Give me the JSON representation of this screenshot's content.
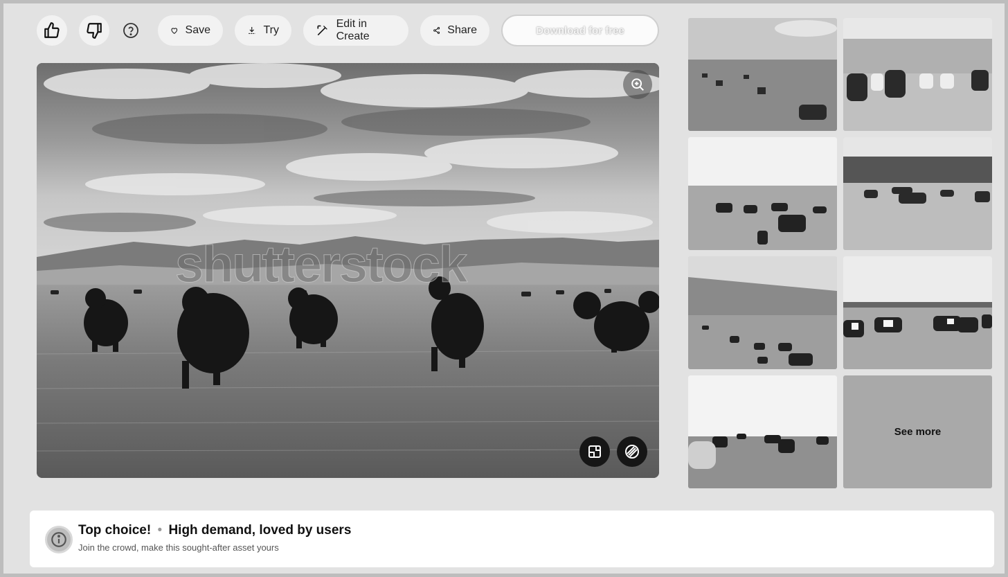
{
  "toolbar": {
    "like_label": "",
    "dislike_label": "",
    "save_label": "Save",
    "try_label": "Try",
    "edit_label": "Edit in Create",
    "share_label": "Share",
    "download_label": "Download for free"
  },
  "hero": {
    "watermark": "shutterstock"
  },
  "grid": {
    "see_more_label": "See more"
  },
  "banner": {
    "title": "Top choice!",
    "separator": "•",
    "highlight": "High demand, loved by users",
    "subtitle": "Join the crowd, make this sought-after asset yours"
  },
  "icons": {
    "like": "thumbs-up-icon",
    "dislike": "thumbs-down-icon",
    "help": "question-circle-icon",
    "save": "heart-icon",
    "try": "download-arrow-icon",
    "edit": "edit-wand-icon",
    "share": "share-icon",
    "zoom": "zoom-in-icon",
    "crop": "crop-icon",
    "mask": "brush-icon",
    "badge": "info-badge-icon"
  }
}
